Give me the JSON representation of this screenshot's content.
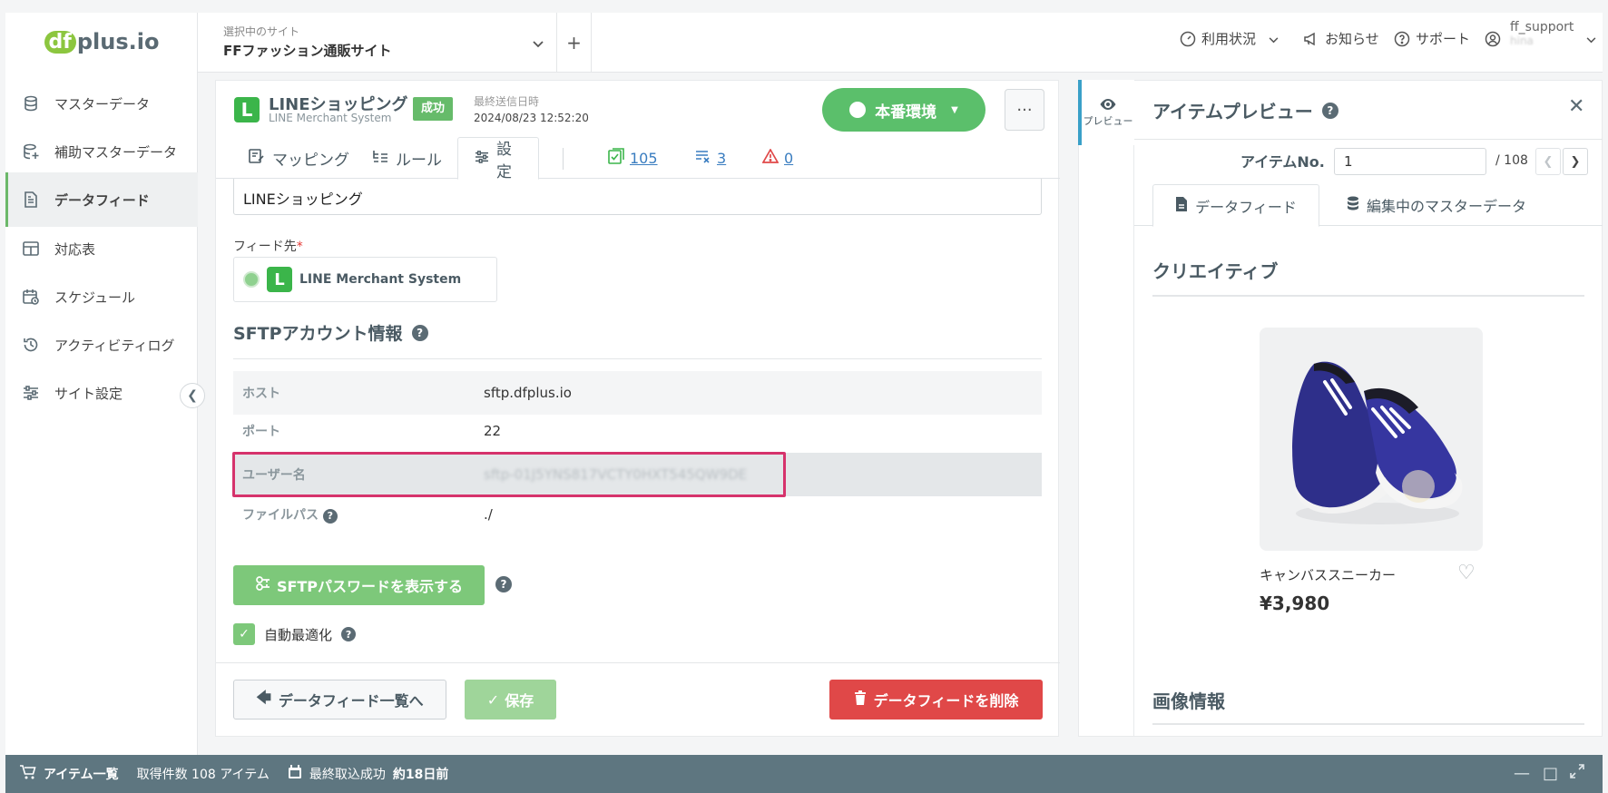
{
  "app": {
    "logo_df": "df",
    "logo_rest": "plus.io"
  },
  "sidebar": {
    "items": [
      {
        "label": "マスターデータ",
        "icon": "database-icon"
      },
      {
        "label": "補助マスターデータ",
        "icon": "database-plus-icon"
      },
      {
        "label": "データフィード",
        "icon": "document-icon",
        "active": true
      },
      {
        "label": "対応表",
        "icon": "table-icon"
      },
      {
        "label": "スケジュール",
        "icon": "calendar-icon"
      },
      {
        "label": "アクティビティログ",
        "icon": "history-icon"
      },
      {
        "label": "サイト設定",
        "icon": "sliders-icon"
      }
    ]
  },
  "topbar": {
    "site_label": "選択中のサイト",
    "site_value": "FFファッション通販サイト",
    "usage": "利用状況",
    "news": "お知らせ",
    "support": "サポート",
    "user": "ff_support",
    "user_sub": "hina"
  },
  "feed": {
    "title": "LINEショッピング",
    "subtitle": "LINE Merchant System",
    "status": "成功",
    "last_sent_label": "最終送信日時",
    "last_sent_value": "2024/08/23 12:52:20",
    "env": "本番環境",
    "logo_letter": "L"
  },
  "tabs": {
    "mapping": "マッピング",
    "rule": "ルール",
    "settings": "設定",
    "count_ok": "105",
    "count_x": "3",
    "count_warn": "0"
  },
  "form": {
    "name_value": "LINEショッピング",
    "dest_label": "フィード先",
    "dest_required": "*",
    "dest_value": "LINE Merchant System",
    "sftp_title": "SFTPアカウント情報",
    "rows": [
      {
        "key": "ホスト",
        "value": "sftp.dfplus.io"
      },
      {
        "key": "ポート",
        "value": "22"
      },
      {
        "key": "ユーザー名",
        "value": "sftp-01J5YNS817VCTY0HXT545QW9DE"
      },
      {
        "key": "ファイルパス",
        "value": "./"
      }
    ],
    "pw_button": "SFTPパスワードを表示する",
    "auto_opt": "自動最適化"
  },
  "footer": {
    "back": "データフィード一覧へ",
    "save": "保存",
    "delete": "データフィードを削除"
  },
  "preview": {
    "toggle_label": "プレビュー",
    "title": "アイテムプレビュー",
    "item_no_label": "アイテムNo.",
    "item_no_value": "1",
    "item_total": "/ 108",
    "tab_feed": "データフィード",
    "tab_master": "編集中のマスターデータ",
    "creative": "クリエイティブ",
    "product_name": "キャンバススニーカー",
    "product_price": "¥3,980",
    "image_info": "画像情報"
  },
  "bottombar": {
    "items_label": "アイテム一覧",
    "count_label": "取得件数 108 アイテム",
    "last_import_label": "最終取込成功",
    "last_import_value": "約18日前"
  },
  "colors": {
    "accent_green": "#5bbf6b",
    "danger": "#e04848",
    "highlight": "#d6336c",
    "bottom_bar": "#5e7680"
  }
}
